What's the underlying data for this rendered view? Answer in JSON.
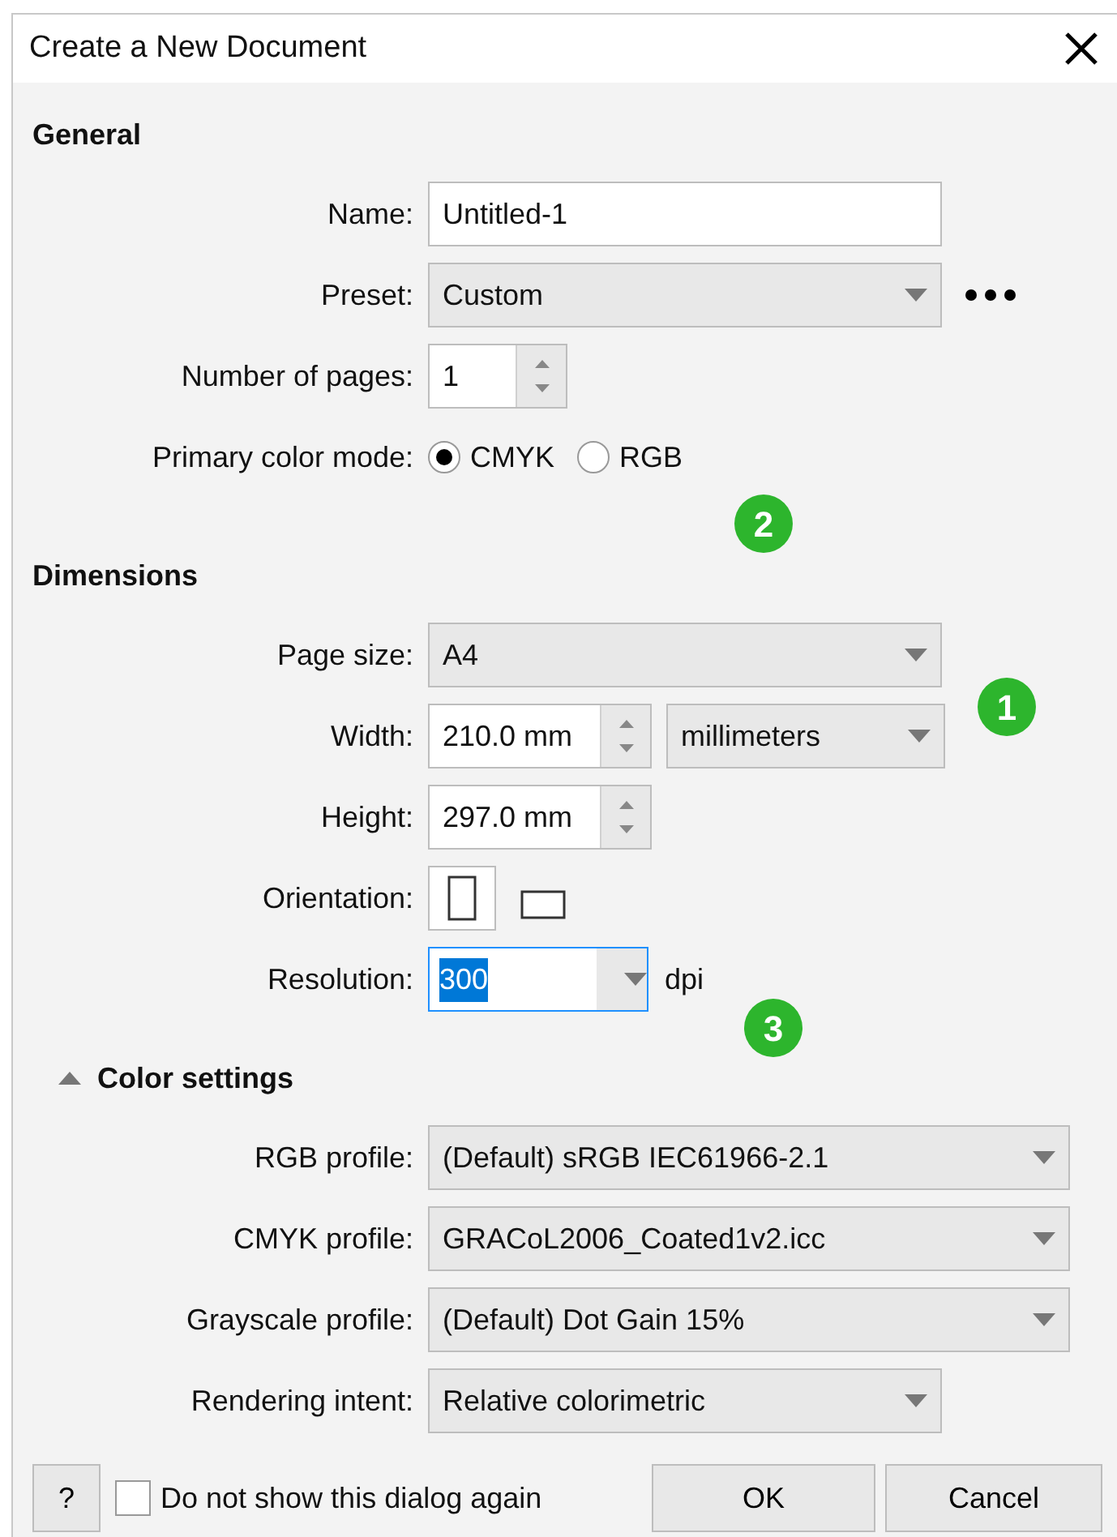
{
  "window": {
    "title": "Create a New Document"
  },
  "sections": [
    {
      "title": "General",
      "collapsible": false,
      "fields": [
        {
          "kind": "text",
          "label": "Name:",
          "value": "Untitled-1"
        },
        {
          "kind": "select",
          "label": "Preset:",
          "value": "Custom",
          "more": true
        },
        {
          "kind": "spin",
          "label": "Number of pages:",
          "value": "1"
        },
        {
          "kind": "radio",
          "label": "Primary color mode:",
          "options": [
            {
              "label": "CMYK",
              "selected": true
            },
            {
              "label": "RGB",
              "selected": false
            }
          ]
        }
      ]
    },
    {
      "title": "Dimensions",
      "collapsible": false,
      "fields": [
        {
          "kind": "select",
          "label": "Page size:",
          "value": "A4"
        },
        {
          "kind": "spin",
          "label": "Width:",
          "value": "210.0 mm",
          "unit_select": "millimeters",
          "wide": true
        },
        {
          "kind": "spin",
          "label": "Height:",
          "value": "297.0 mm",
          "wide": true
        },
        {
          "kind": "orientation",
          "label": "Orientation:",
          "options": [
            {
              "kind": "portrait",
              "selected": true
            },
            {
              "kind": "landscape",
              "selected": false
            }
          ]
        },
        {
          "kind": "combo",
          "label": "Resolution:",
          "value": "300",
          "focused": true,
          "unit": "dpi"
        }
      ]
    },
    {
      "title": "Color settings",
      "collapsible": true,
      "expanded": true,
      "fields": [
        {
          "kind": "select",
          "label": "RGB profile:",
          "value": "(Default) sRGB IEC61966-2.1",
          "wide": true
        },
        {
          "kind": "select",
          "label": "CMYK profile:",
          "value": "GRACoL2006_Coated1v2.icc",
          "wide": true
        },
        {
          "kind": "select",
          "label": "Grayscale profile:",
          "value": "(Default) Dot Gain 15%",
          "wide": true
        },
        {
          "kind": "select",
          "label": "Rendering intent:",
          "value": "Relative colorimetric"
        }
      ]
    }
  ],
  "footer": {
    "help": "?",
    "checkbox": {
      "label": "Do not show this dialog again",
      "checked": false
    },
    "buttons": [
      "OK",
      "Cancel"
    ]
  },
  "callouts": [
    "2",
    "1",
    "3"
  ]
}
